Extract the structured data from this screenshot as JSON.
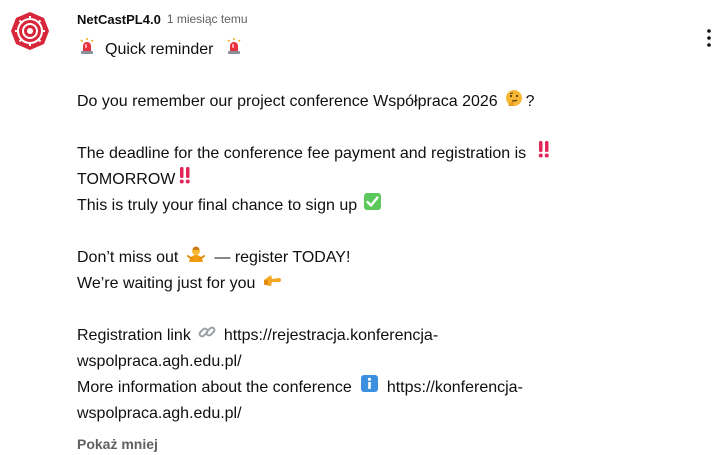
{
  "comment": {
    "author": "NetCastPL4.0",
    "timestamp": "1 miesiąc temu",
    "avatar_icon": "gear-seal-icon",
    "avatar_color": "#d8263a",
    "lines": {
      "reminder": "Quick reminder",
      "question_a": "Do you remember our project conference Współpraca 2026",
      "question_b": "?",
      "deadline_a": "The deadline for the conference fee payment and registration is",
      "deadline_b": "TOMORROW",
      "final_chance": "This is truly your final chance to sign up",
      "dont_miss_a": "Don’t miss out",
      "dont_miss_b": "— register TODAY!",
      "waiting": "We’re waiting just for you",
      "reg_link_a": "Registration link",
      "reg_link_b": "https://rejestracja.konferencja-",
      "reg_link_c": "wspolpraca.agh.edu.pl/",
      "more_info_a": "More information about the conference",
      "more_info_b": "https://konferencja-",
      "more_info_c": "wspolpraca.agh.edu.pl/"
    },
    "emoji": {
      "siren": "rotating-light-icon",
      "thinking": "thinking-face-icon",
      "exclamation": "double-exclamation-icon",
      "check": "check-mark-button-icon",
      "person": "person-gesturing-icon",
      "point": "backhand-index-pointing-icon",
      "link": "link-icon",
      "info": "information-icon"
    },
    "show_less": "Pokaż mniej"
  }
}
